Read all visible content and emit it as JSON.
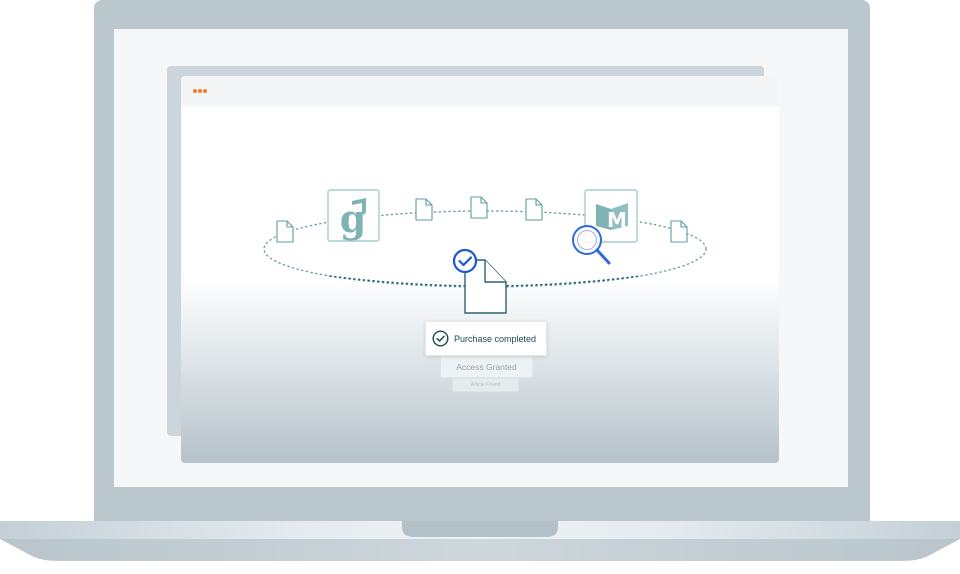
{
  "colors": {
    "accent_orange": "#ef7d2d",
    "check_blue": "#1e55d6",
    "teal": "#5e9e9f",
    "dark_teal": "#1f4850"
  },
  "icons": {
    "window_controls": "three-dots-icon",
    "scholar": "google-scholar-logo-icon",
    "library": "m-library-logo-icon",
    "search": "magnifier-icon",
    "document": "document-icon",
    "verified": "check-circle-icon"
  },
  "status": {
    "purchase": "Purchase completed",
    "access": "Access Granted",
    "article": "Article Found"
  }
}
